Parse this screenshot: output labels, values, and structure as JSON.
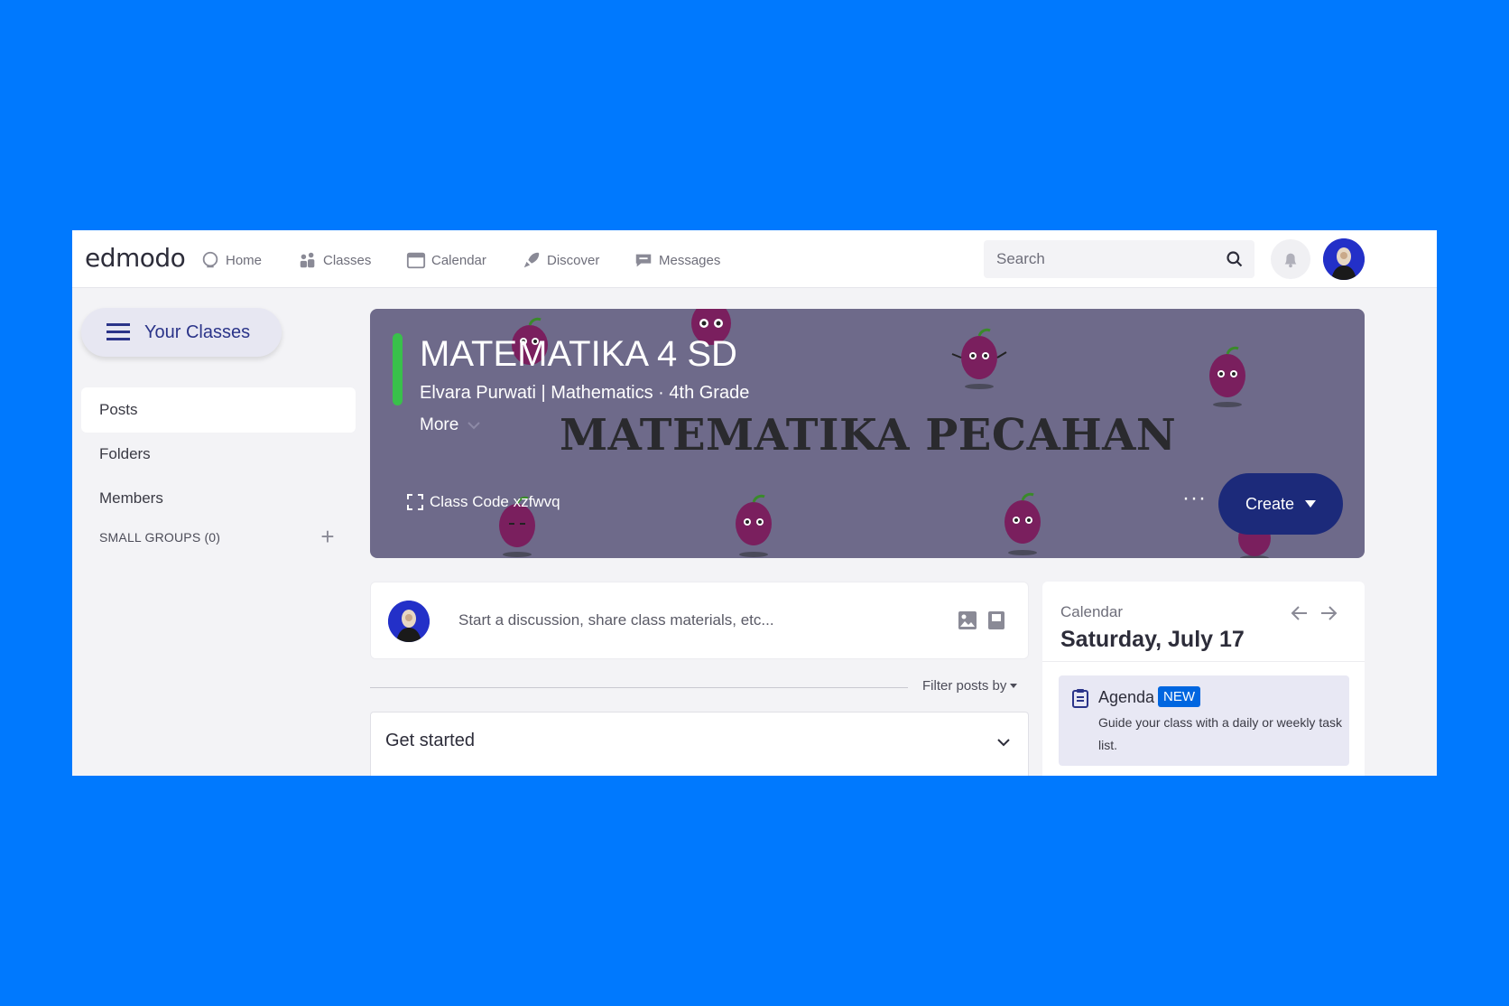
{
  "brand": {
    "logo": "edmodo"
  },
  "nav": [
    {
      "label": "Home",
      "icon": "home-icon"
    },
    {
      "label": "Classes",
      "icon": "classes-icon"
    },
    {
      "label": "Calendar",
      "icon": "calendar-icon"
    },
    {
      "label": "Discover",
      "icon": "rocket-icon"
    },
    {
      "label": "Messages",
      "icon": "message-icon"
    }
  ],
  "search": {
    "placeholder": "Search"
  },
  "sidebar": {
    "your_classes": "Your Classes",
    "items": [
      {
        "label": "Posts",
        "active": true
      },
      {
        "label": "Folders",
        "active": false
      },
      {
        "label": "Members",
        "active": false
      }
    ],
    "small_groups": "SMALL GROUPS (0)",
    "add_symbol": "+"
  },
  "banner": {
    "title": "MATEMATIKA 4 SD",
    "subtitle": "Elvara Purwati | Mathematics  · 4th Grade",
    "more": "More",
    "art_title": "MATEMATIKA PECAHAN",
    "class_code": "Class Code xzfwvq",
    "dots": "···",
    "create": "Create",
    "colors": {
      "background": "#6e6a8a",
      "accent": "#39c04b",
      "create_button": "#1c2a7a"
    }
  },
  "composer": {
    "placeholder": "Start a discussion, share class materials, etc..."
  },
  "feed": {
    "filter": "Filter posts by",
    "get_started": "Get started"
  },
  "calendar": {
    "label": "Calendar",
    "date": "Saturday, July 17",
    "agenda": {
      "title": "Agenda",
      "badge": "NEW",
      "description": "Guide your class with a daily or weekly task list."
    }
  }
}
